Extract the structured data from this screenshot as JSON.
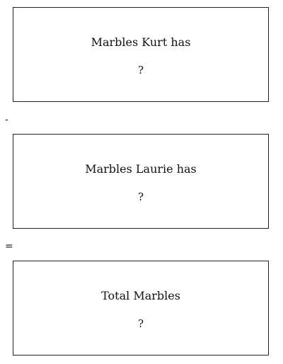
{
  "boxes": [
    {
      "label": "Marbles Kurt has",
      "value": "?"
    },
    {
      "label": "Marbles Laurie has",
      "value": "?"
    },
    {
      "label": "Total Marbles",
      "value": "?"
    }
  ],
  "operators": {
    "first": "-",
    "second": "="
  }
}
